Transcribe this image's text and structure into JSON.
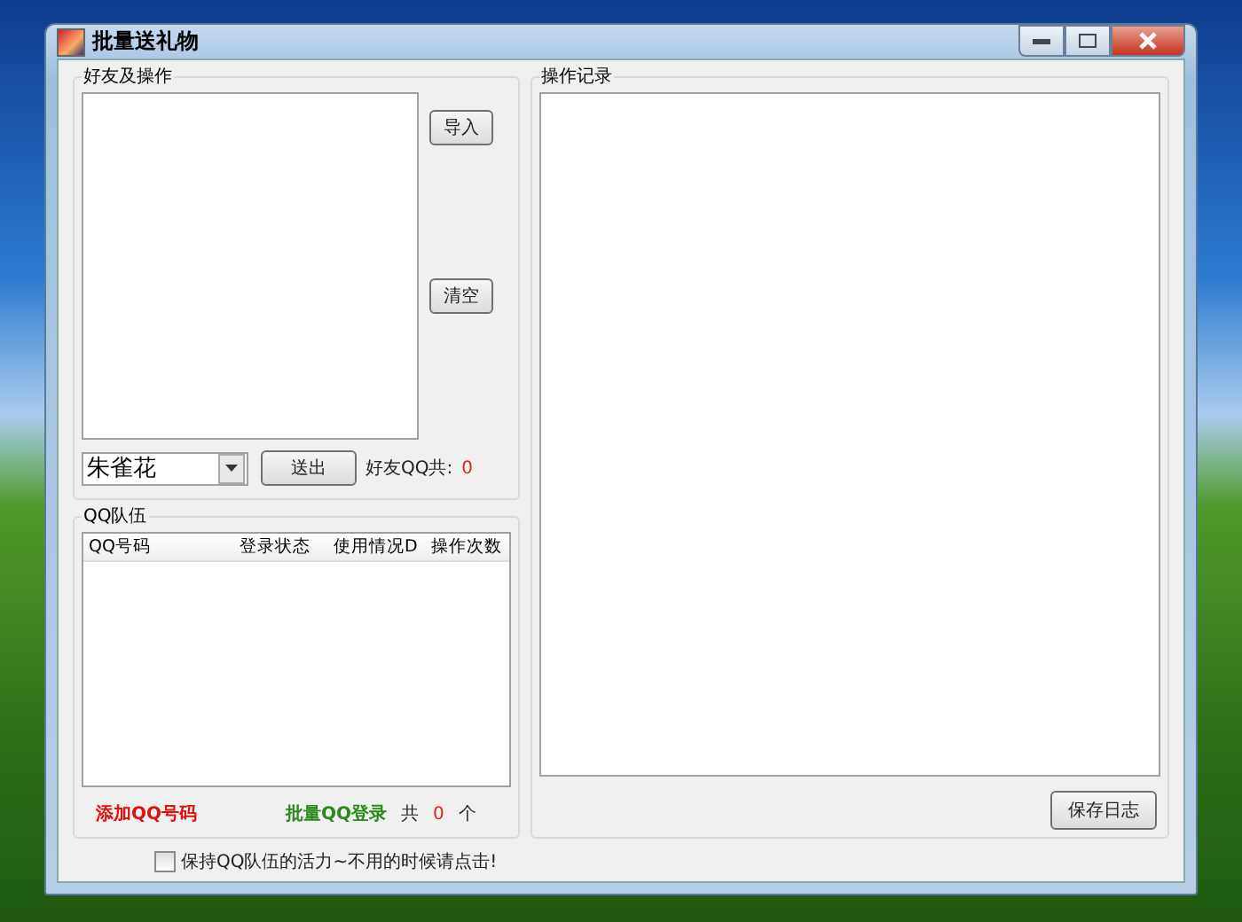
{
  "window": {
    "title": "批量送礼物"
  },
  "friends_group": {
    "title": "好友及操作",
    "import_button": "导入",
    "clear_button": "清空",
    "friend_select": {
      "value": "朱雀花"
    },
    "send_button": "送出",
    "friend_count_label": "好友QQ共:",
    "friend_count": "0"
  },
  "team_group": {
    "title": "QQ队伍",
    "columns": [
      "QQ号码",
      "登录状态",
      "使用情况D",
      "操作次数"
    ],
    "add_link": "添加QQ号码",
    "login_link": "批量QQ登录",
    "total_prefix": "共",
    "total": "0",
    "total_suffix": "个"
  },
  "log_group": {
    "title": "操作记录",
    "save_button": "保存日志"
  },
  "keep_alive": {
    "label": "保持QQ队伍的活力~不用的时候请点击!",
    "checked": false
  }
}
